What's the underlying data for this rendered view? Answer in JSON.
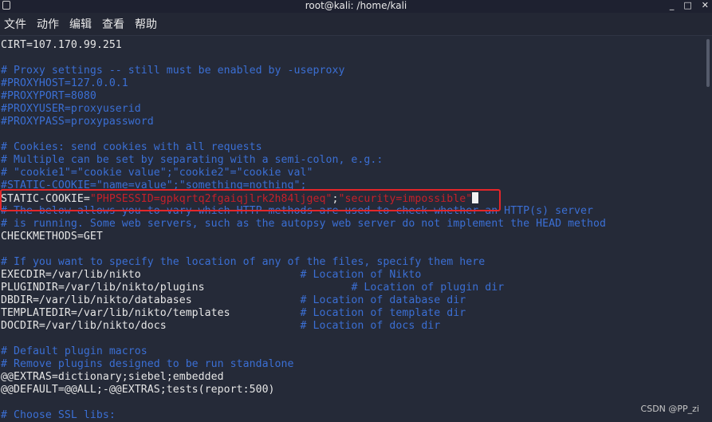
{
  "window": {
    "title": "root@kali: /home/kali",
    "minimize": "_",
    "maximize": "□",
    "close": "✕"
  },
  "menu": [
    "文件",
    "动作",
    "编辑",
    "查看",
    "帮助"
  ],
  "lines": [
    [
      [
        "t",
        "CIRT=107.170.99.251"
      ]
    ],
    [],
    [
      [
        "c",
        "# Proxy settings -- still must be enabled by -useproxy"
      ]
    ],
    [
      [
        "c",
        "#PROXYHOST=127.0.0.1"
      ]
    ],
    [
      [
        "c",
        "#PROXYPORT=8080"
      ]
    ],
    [
      [
        "c",
        "#PROXYUSER=proxyuserid"
      ]
    ],
    [
      [
        "c",
        "#PROXYPASS=proxypassword"
      ]
    ],
    [],
    [
      [
        "c",
        "# Cookies: send cookies with all requests"
      ]
    ],
    [
      [
        "c",
        "# Multiple can be set by separating with a semi-colon, e.g.:"
      ]
    ],
    [
      [
        "c",
        "# \"cookie1\"=\"cookie value\";\"cookie2\"=\"cookie val\""
      ]
    ],
    [
      [
        "c",
        "#STATIC-COOKIE=\"name=value\";\"something=nothing\";"
      ]
    ],
    [
      [
        "t",
        "STATIC-COOKIE="
      ],
      [
        "s",
        "\"PHPSESSID=gpkqrtq2fgaiqjlrk2h84ljgeq\""
      ],
      [
        "t",
        ";"
      ],
      [
        "s",
        "\"security=impossible\""
      ]
    ],
    [
      [
        "c",
        "# The below allows you to vary which HTTP methods are used to check whether an HTTP(s) server"
      ]
    ],
    [
      [
        "c",
        "# is running. Some web servers, such as the autopsy web server do not implement the HEAD method"
      ]
    ],
    [
      [
        "t",
        "CHECKMETHODS=GET"
      ]
    ],
    [],
    [
      [
        "c",
        "# If you want to specify the location of any of the files, specify them here"
      ]
    ],
    [
      [
        "t",
        "EXECDIR=/var/lib/nikto                         "
      ],
      [
        "c",
        "# Location of Nikto"
      ]
    ],
    [
      [
        "t",
        "PLUGINDIR=/var/lib/nikto/plugins                       "
      ],
      [
        "c",
        "# Location of plugin dir"
      ]
    ],
    [
      [
        "t",
        "DBDIR=/var/lib/nikto/databases                 "
      ],
      [
        "c",
        "# Location of database dir"
      ]
    ],
    [
      [
        "t",
        "TEMPLATEDIR=/var/lib/nikto/templates           "
      ],
      [
        "c",
        "# Location of template dir"
      ]
    ],
    [
      [
        "t",
        "DOCDIR=/var/lib/nikto/docs                     "
      ],
      [
        "c",
        "# Location of docs dir"
      ]
    ],
    [],
    [
      [
        "c",
        "# Default plugin macros"
      ]
    ],
    [
      [
        "c",
        "# Remove plugins designed to be run standalone"
      ]
    ],
    [
      [
        "t",
        "@@EXTRAS=dictionary;siebel;embedded"
      ]
    ],
    [
      [
        "t",
        "@@DEFAULT=@@ALL;-@@EXTRAS;tests(report:500)"
      ]
    ],
    [],
    [
      [
        "c",
        "# Choose SSL libs:"
      ]
    ]
  ],
  "highlight_line": 12,
  "cursor_line": 12,
  "watermark": "CSDN @PP_zi",
  "colors": {
    "background": "#252a38",
    "comment": "#3b6fd4",
    "string": "#c4202a",
    "highlight_box": "#e3262a"
  }
}
